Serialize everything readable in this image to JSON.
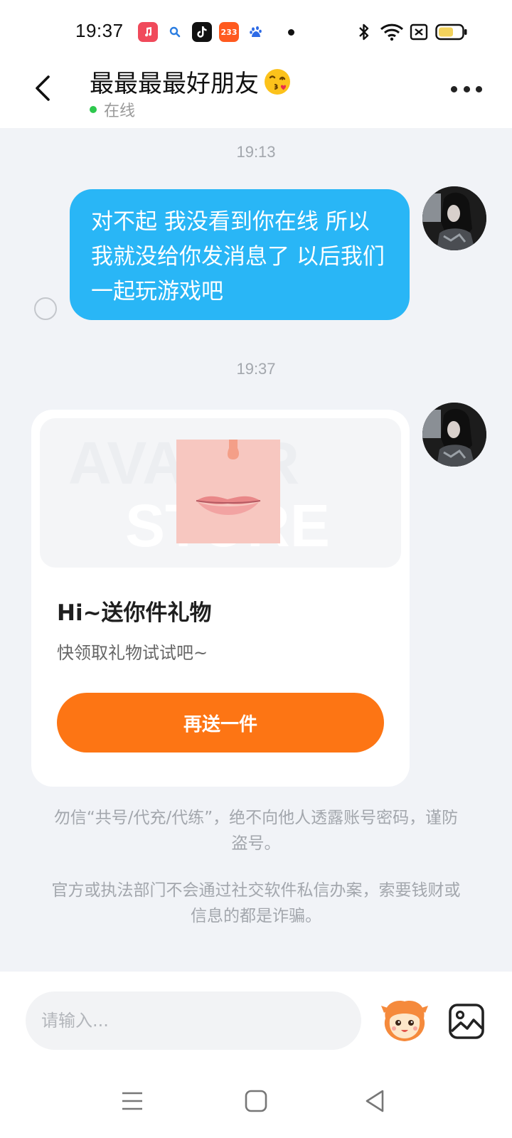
{
  "status_bar": {
    "time": "19:37",
    "apps": [
      {
        "name": "music-app-icon",
        "color": "#f04a5b",
        "glyph": "♫"
      },
      {
        "name": "search-app-icon",
        "color": "#ffffff",
        "glyph": "🔍"
      },
      {
        "name": "tiktok-app-icon",
        "color": "#111111",
        "glyph": "♪"
      },
      {
        "name": "233-app-icon",
        "color": "#ff5a1f",
        "glyph": "233"
      },
      {
        "name": "baidu-app-icon",
        "color": "#ffffff",
        "glyph": "du"
      }
    ],
    "battery_level": 0.6
  },
  "header": {
    "title": "最最最最好朋友",
    "presence": "在线"
  },
  "messages": {
    "ts1": "19:13",
    "text1": "对不起 我没看到你在线 所以我就没给你发消息了 以后我们一起玩游戏吧",
    "ts2": "19:37"
  },
  "gift_card": {
    "watermark": "AVATAR STORE",
    "title": "Hi~送你件礼物",
    "subtitle": "快领取礼物试试吧~",
    "button_label": "再送一件"
  },
  "notices": {
    "notice1": "勿信“共号/代充/代练”，绝不向他人透露账号密码，谨防盗号。",
    "notice2": "官方或执法部门不会通过社交软件私信办案，索要钱财或信息的都是诈骗。"
  },
  "input": {
    "placeholder": "请输入..."
  },
  "colors": {
    "accent_blue": "#29b6f6",
    "accent_orange": "#fd7514",
    "online_green": "#2dc84d"
  }
}
